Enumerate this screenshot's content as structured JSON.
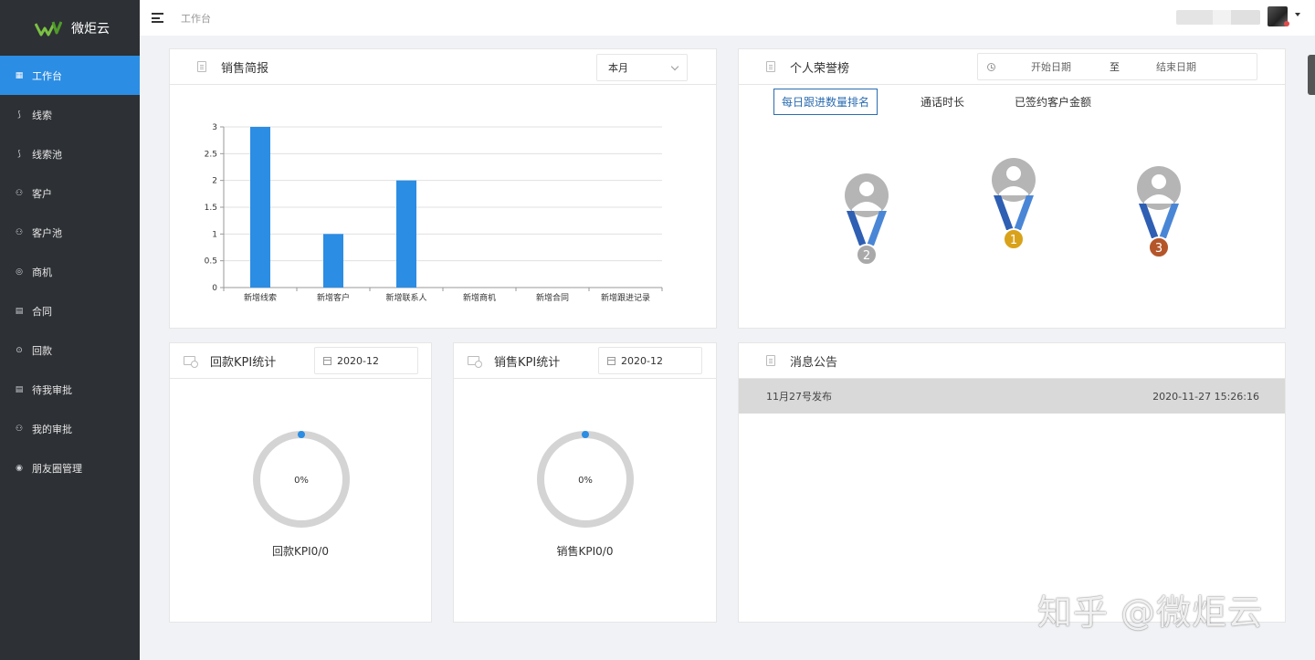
{
  "app": {
    "name": "微炬云"
  },
  "header": {
    "breadcrumb": "工作台"
  },
  "sidebar": {
    "items": [
      {
        "label": "工作台",
        "icon": "grid-icon",
        "active": true
      },
      {
        "label": "线索",
        "icon": "clue-icon"
      },
      {
        "label": "线索池",
        "icon": "clue-pool-icon"
      },
      {
        "label": "客户",
        "icon": "customer-icon"
      },
      {
        "label": "客户池",
        "icon": "customer-pool-icon"
      },
      {
        "label": "商机",
        "icon": "opportunity-icon"
      },
      {
        "label": "合同",
        "icon": "contract-icon"
      },
      {
        "label": "回款",
        "icon": "payment-icon"
      },
      {
        "label": "待我审批",
        "icon": "pending-approval-icon"
      },
      {
        "label": "我的审批",
        "icon": "my-approval-icon"
      },
      {
        "label": "朋友圈管理",
        "icon": "moments-icon"
      }
    ]
  },
  "sales_report": {
    "title": "销售简报",
    "period_select": "本月"
  },
  "chart_data": {
    "type": "bar",
    "categories": [
      "新增线索",
      "新增客户",
      "新增联系人",
      "新增商机",
      "新增合同",
      "新增跟进记录"
    ],
    "values": [
      3,
      1,
      2,
      0,
      0,
      0
    ],
    "ylim": [
      0,
      3
    ],
    "yticks": [
      "0",
      "0.5",
      "1",
      "1.5",
      "2",
      "2.5",
      "3"
    ],
    "grid": true,
    "bar_color": "#2b8de3"
  },
  "honor": {
    "title": "个人荣誉榜",
    "date_start_placeholder": "开始日期",
    "date_separator": "至",
    "date_end_placeholder": "结束日期",
    "tabs": [
      "每日跟进数量排名",
      "通话时长",
      "已签约客户金额"
    ],
    "medals": [
      {
        "rank": "2",
        "color": "#a9a9a9"
      },
      {
        "rank": "1",
        "color": "#d9a21b"
      },
      {
        "rank": "3",
        "color": "#b4562a"
      }
    ]
  },
  "kpi_payment": {
    "title": "回款KPI统计",
    "month": "2020-12",
    "percent_text": "0%",
    "percent": 0,
    "label": "回款KPI0/0"
  },
  "kpi_sales": {
    "title": "销售KPI统计",
    "month": "2020-12",
    "percent_text": "0%",
    "percent": 0,
    "label": "销售KPI0/0"
  },
  "notice": {
    "title": "消息公告",
    "items": [
      {
        "title": "11月27号发布",
        "time": "2020-11-27 15:26:16"
      }
    ]
  },
  "watermark": "知乎 @微炬云"
}
